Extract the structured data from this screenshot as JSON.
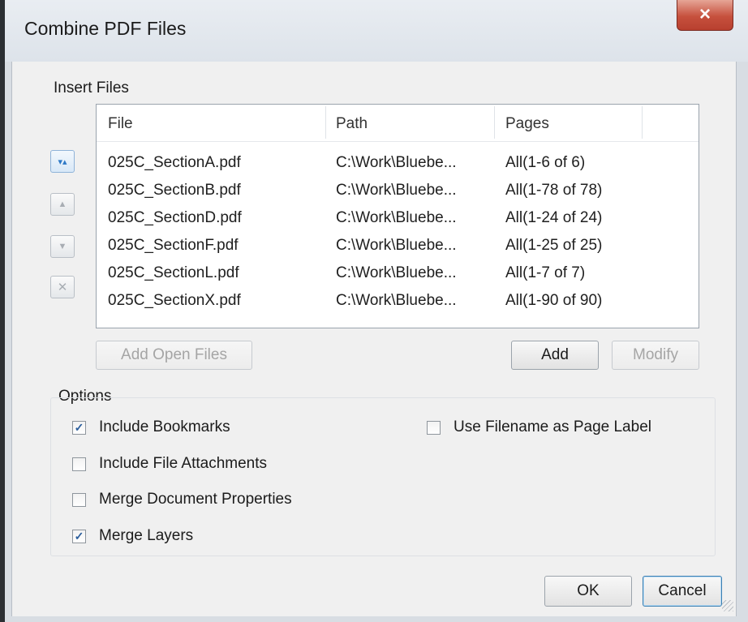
{
  "window": {
    "title": "Combine PDF Files",
    "close_glyph": "×"
  },
  "insert_files": {
    "group_label": "Insert Files",
    "columns": [
      "File",
      "Path",
      "Pages"
    ],
    "rows": [
      {
        "file": "025C_SectionA.pdf",
        "path": "C:\\Work\\Bluebe...",
        "pages": "All(1-6 of 6)"
      },
      {
        "file": "025C_SectionB.pdf",
        "path": "C:\\Work\\Bluebe...",
        "pages": "All(1-78 of 78)"
      },
      {
        "file": "025C_SectionD.pdf",
        "path": "C:\\Work\\Bluebe...",
        "pages": "All(1-24 of 24)"
      },
      {
        "file": "025C_SectionF.pdf",
        "path": "C:\\Work\\Bluebe...",
        "pages": "All(1-25 of 25)"
      },
      {
        "file": "025C_SectionL.pdf",
        "path": "C:\\Work\\Bluebe...",
        "pages": "All(1-7 of 7)"
      },
      {
        "file": "025C_SectionX.pdf",
        "path": "C:\\Work\\Bluebe...",
        "pages": "All(1-90 of 90)"
      }
    ],
    "side_buttons": [
      {
        "name": "move-to-top",
        "glyph": "▾▴",
        "active": true
      },
      {
        "name": "move-up",
        "glyph": "▲",
        "active": false
      },
      {
        "name": "move-down",
        "glyph": "▼",
        "active": false
      },
      {
        "name": "remove",
        "glyph": "✕",
        "active": false
      }
    ],
    "add_open_files_label": "Add Open Files",
    "add_label": "Add",
    "modify_label": "Modify"
  },
  "options": {
    "group_label": "Options",
    "include_bookmarks": {
      "label": "Include Bookmarks",
      "checked": true
    },
    "include_file_attachments": {
      "label": "Include File Attachments",
      "checked": false
    },
    "merge_document_properties": {
      "label": "Merge Document Properties",
      "checked": false
    },
    "merge_layers": {
      "label": "Merge Layers",
      "checked": true
    },
    "use_filename_as_page_label": {
      "label": "Use Filename as Page Label",
      "checked": false
    }
  },
  "footer": {
    "ok_label": "OK",
    "cancel_label": "Cancel"
  },
  "colors": {
    "accent": "#3c7fb1",
    "close_button": "#c6503d",
    "check": "#2a5d9c"
  }
}
